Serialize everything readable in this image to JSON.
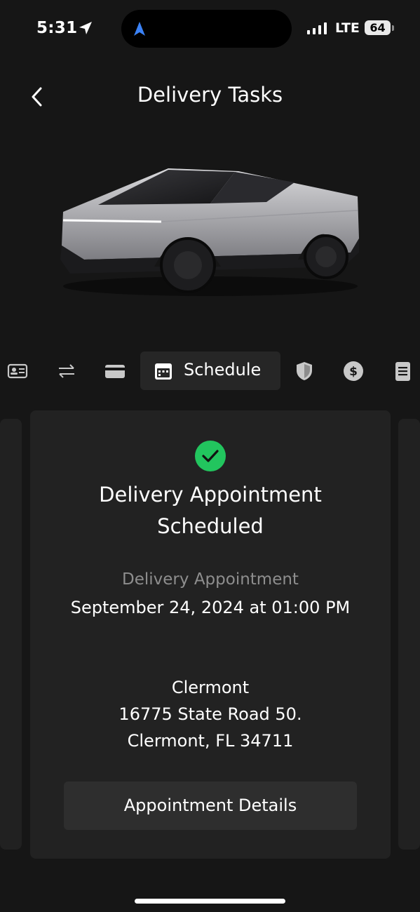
{
  "status_bar": {
    "time": "5:31",
    "network": "LTE",
    "battery": "64"
  },
  "header": {
    "title": "Delivery Tasks"
  },
  "tabs": [
    {
      "name": "id-card-icon"
    },
    {
      "name": "transfer-icon"
    },
    {
      "name": "payment-card-icon"
    },
    {
      "name": "calendar-icon",
      "label": "Schedule",
      "active": true
    },
    {
      "name": "shield-icon"
    },
    {
      "name": "dollar-icon"
    },
    {
      "name": "document-icon"
    }
  ],
  "card": {
    "title_line1": "Delivery Appointment",
    "title_line2": "Scheduled",
    "appointment_label": "Delivery Appointment",
    "appointment_date": "September 24, 2024 at 01:00 PM",
    "location_name": "Clermont",
    "address_line1": "16775 State Road 50.",
    "address_line2": "Clermont, FL 34711",
    "details_button": "Appointment Details"
  },
  "colors": {
    "background": "#161616",
    "card": "#222222",
    "success": "#22c55e",
    "muted_text": "#8e8e8e"
  }
}
